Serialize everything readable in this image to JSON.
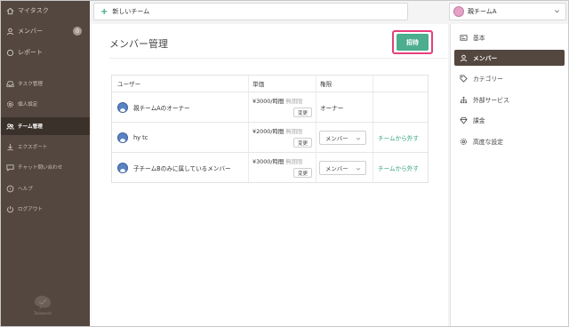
{
  "sidebar": {
    "items": [
      {
        "label": "マイタスク",
        "icon": "home-icon"
      },
      {
        "label": "メンバー",
        "icon": "person-icon",
        "badge": "0"
      },
      {
        "label": "レポート",
        "icon": "circle-icon"
      },
      {
        "label": "タスク管理",
        "icon": "tray-icon"
      },
      {
        "label": "個人設定",
        "icon": "gear-icon"
      },
      {
        "label": "チーム管理",
        "icon": "people-icon"
      },
      {
        "label": "エクスポート",
        "icon": "download-icon"
      },
      {
        "label": "チャット問い合わせ",
        "icon": "chat-icon"
      },
      {
        "label": "ヘルプ",
        "icon": "help-icon"
      },
      {
        "label": "ログアウト",
        "icon": "power-icon"
      }
    ],
    "logo_text": "Taskworld"
  },
  "topbar": {
    "new_team": "新しいチーム",
    "team_name": "親チームA"
  },
  "main": {
    "title": "メンバー管理",
    "invite_button": "招待",
    "table": {
      "headers": [
        "ユーザー",
        "単価",
        "権限"
      ],
      "rows": [
        {
          "user": "親チームAのオーナー",
          "price": "¥3000/時間",
          "limit": "無期限",
          "change": "変更",
          "role": "オーナー",
          "role_editable": false,
          "remove": ""
        },
        {
          "user": "hy tc",
          "price": "¥2000/時間",
          "limit": "無期限",
          "change": "変更",
          "role": "メンバー",
          "role_editable": true,
          "remove": "チームから外す"
        },
        {
          "user": "子チームBのみに属しているメンバー",
          "price": "¥3000/時間",
          "limit": "無期限",
          "change": "変更",
          "role": "メンバー",
          "role_editable": true,
          "remove": "チームから外す"
        }
      ]
    }
  },
  "settings_nav": [
    {
      "label": "基本",
      "icon": "card-icon"
    },
    {
      "label": "メンバー",
      "icon": "person-icon",
      "active": true
    },
    {
      "label": "カテゴリー",
      "icon": "tag-icon"
    },
    {
      "label": "外部サービス",
      "icon": "network-icon"
    },
    {
      "label": "課金",
      "icon": "diamond-icon"
    },
    {
      "label": "高度な設定",
      "icon": "gear-icon"
    }
  ],
  "colors": {
    "sidebar_bg": "#54473f",
    "accent_green": "#4cae8e",
    "highlight_pink": "#e5407b"
  }
}
